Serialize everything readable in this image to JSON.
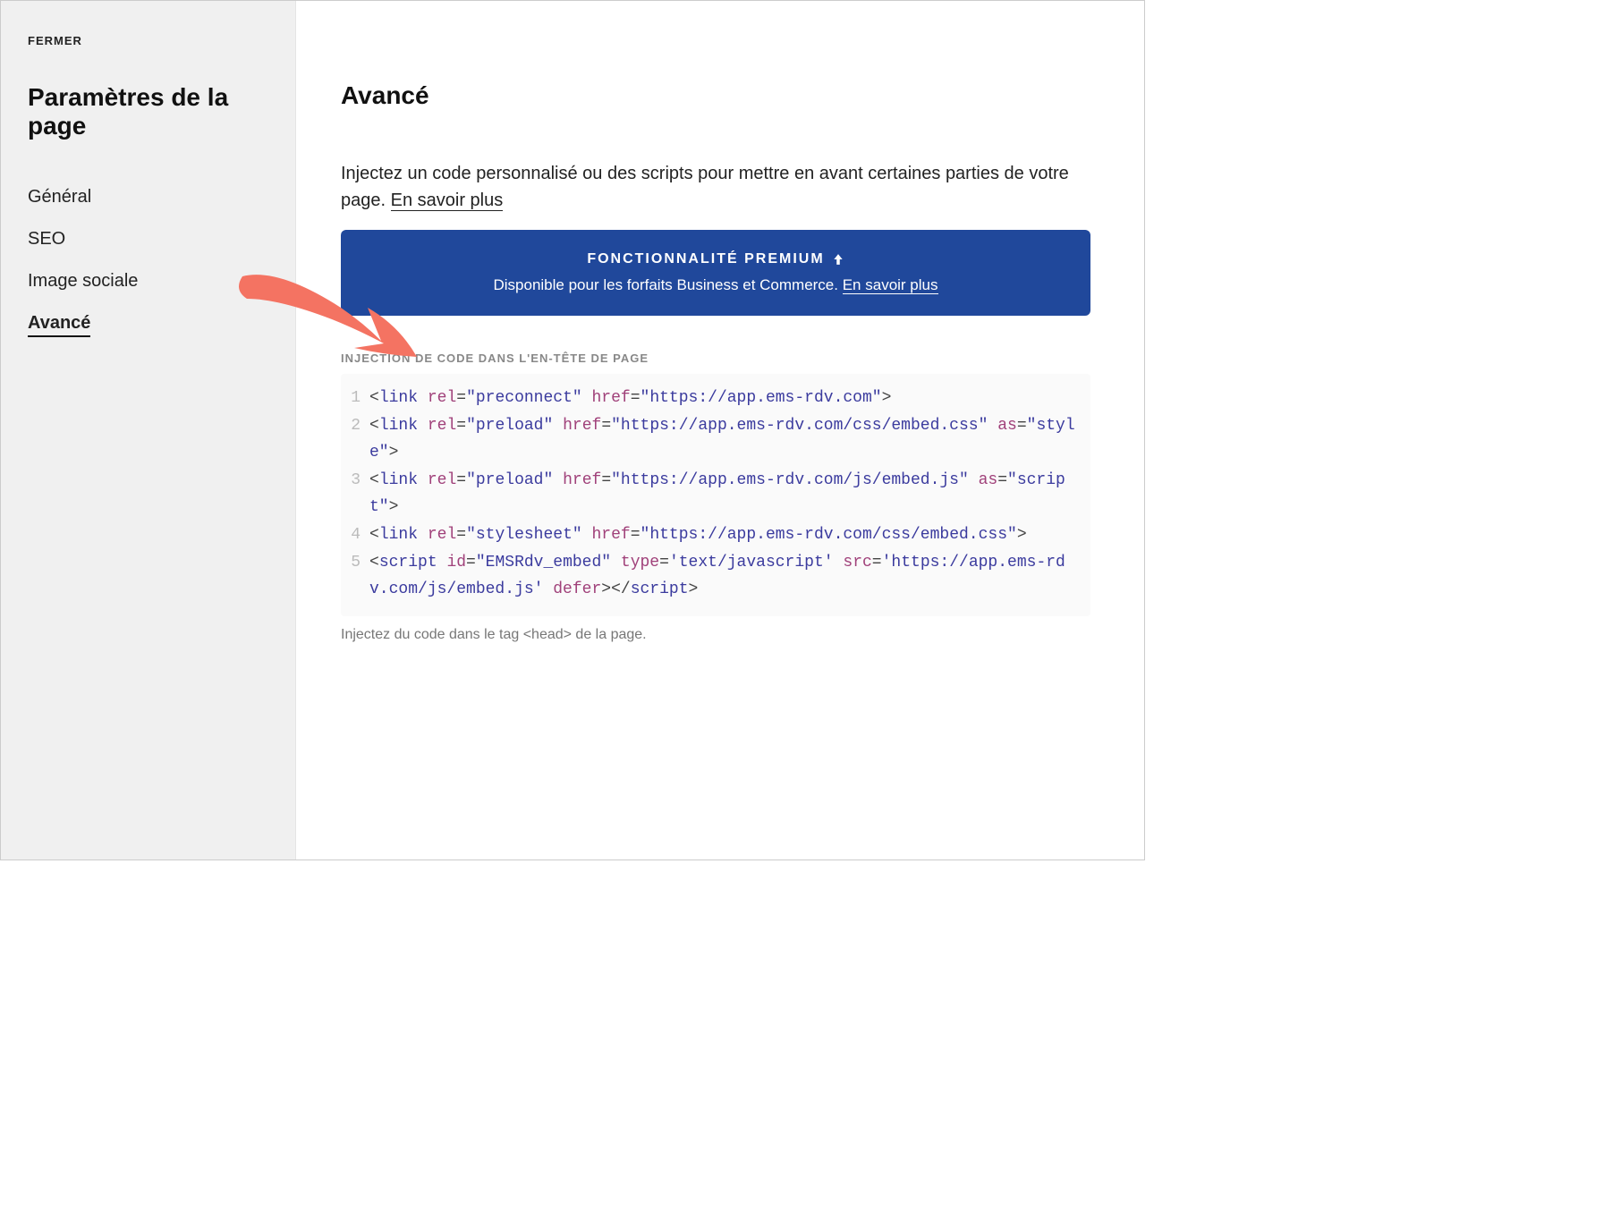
{
  "sidebar": {
    "close": "FERMER",
    "title": "Paramètres de la page",
    "items": [
      {
        "label": "Général"
      },
      {
        "label": "SEO"
      },
      {
        "label": "Image sociale"
      },
      {
        "label": "Avancé"
      }
    ]
  },
  "main": {
    "title": "Avancé",
    "intro_part1": "Injectez un code personnalisé ou des scripts pour mettre en avant certaines parties de votre page. ",
    "intro_link": "En savoir plus",
    "premium": {
      "title": "FONCTIONNALITÉ PREMIUM",
      "sub_part1": "Disponible pour les forfaits Business et Commerce. ",
      "sub_link": "En savoir plus"
    },
    "code_section_label": "INJECTION DE CODE DANS L'EN-TÊTE DE PAGE",
    "helper": "Injectez du code dans le tag <head> de la page.",
    "code_lines": [
      {
        "n": "1",
        "tokens": [
          {
            "t": "plain",
            "v": "<"
          },
          {
            "t": "tag",
            "v": "link"
          },
          {
            "t": "plain",
            "v": " "
          },
          {
            "t": "attr",
            "v": "rel"
          },
          {
            "t": "plain",
            "v": "="
          },
          {
            "t": "val",
            "v": "\"preconnect\""
          },
          {
            "t": "plain",
            "v": " "
          },
          {
            "t": "attr",
            "v": "href"
          },
          {
            "t": "plain",
            "v": "="
          },
          {
            "t": "val",
            "v": "\"https://app.ems-rdv.com\""
          },
          {
            "t": "plain",
            "v": ">"
          }
        ]
      },
      {
        "n": "2",
        "tokens": [
          {
            "t": "plain",
            "v": "<"
          },
          {
            "t": "tag",
            "v": "link"
          },
          {
            "t": "plain",
            "v": " "
          },
          {
            "t": "attr",
            "v": "rel"
          },
          {
            "t": "plain",
            "v": "="
          },
          {
            "t": "val",
            "v": "\"preload\""
          },
          {
            "t": "plain",
            "v": " "
          },
          {
            "t": "attr",
            "v": "href"
          },
          {
            "t": "plain",
            "v": "="
          },
          {
            "t": "val",
            "v": "\"https://app.ems-rdv.com/css/embed.css\""
          },
          {
            "t": "plain",
            "v": " "
          },
          {
            "t": "attr",
            "v": "as"
          },
          {
            "t": "plain",
            "v": "="
          },
          {
            "t": "val",
            "v": "\"style\""
          },
          {
            "t": "plain",
            "v": ">"
          }
        ]
      },
      {
        "n": "3",
        "tokens": [
          {
            "t": "plain",
            "v": "<"
          },
          {
            "t": "tag",
            "v": "link"
          },
          {
            "t": "plain",
            "v": " "
          },
          {
            "t": "attr",
            "v": "rel"
          },
          {
            "t": "plain",
            "v": "="
          },
          {
            "t": "val",
            "v": "\"preload\""
          },
          {
            "t": "plain",
            "v": " "
          },
          {
            "t": "attr",
            "v": "href"
          },
          {
            "t": "plain",
            "v": "="
          },
          {
            "t": "val",
            "v": "\"https://app.ems-rdv.com/js/embed.js\""
          },
          {
            "t": "plain",
            "v": " "
          },
          {
            "t": "attr",
            "v": "as"
          },
          {
            "t": "plain",
            "v": "="
          },
          {
            "t": "val",
            "v": "\"script\""
          },
          {
            "t": "plain",
            "v": ">"
          }
        ]
      },
      {
        "n": "4",
        "tokens": [
          {
            "t": "plain",
            "v": "<"
          },
          {
            "t": "tag",
            "v": "link"
          },
          {
            "t": "plain",
            "v": " "
          },
          {
            "t": "attr",
            "v": "rel"
          },
          {
            "t": "plain",
            "v": "="
          },
          {
            "t": "val",
            "v": "\"stylesheet\""
          },
          {
            "t": "plain",
            "v": " "
          },
          {
            "t": "attr",
            "v": "href"
          },
          {
            "t": "plain",
            "v": "="
          },
          {
            "t": "val",
            "v": "\"https://app.ems-rdv.com/css/embed.css\""
          },
          {
            "t": "plain",
            "v": ">"
          }
        ]
      },
      {
        "n": "5",
        "tokens": [
          {
            "t": "plain",
            "v": "<"
          },
          {
            "t": "tag",
            "v": "script"
          },
          {
            "t": "plain",
            "v": " "
          },
          {
            "t": "attr",
            "v": "id"
          },
          {
            "t": "plain",
            "v": "="
          },
          {
            "t": "val",
            "v": "\"EMSRdv_embed\""
          },
          {
            "t": "plain",
            "v": " "
          },
          {
            "t": "attr",
            "v": "type"
          },
          {
            "t": "plain",
            "v": "="
          },
          {
            "t": "val",
            "v": "'text/javascript'"
          },
          {
            "t": "plain",
            "v": " "
          },
          {
            "t": "attr",
            "v": "src"
          },
          {
            "t": "plain",
            "v": "="
          },
          {
            "t": "val",
            "v": "'https://app.ems-rdv.com/js/embed.js'"
          },
          {
            "t": "plain",
            "v": " "
          },
          {
            "t": "attr",
            "v": "defer"
          },
          {
            "t": "plain",
            "v": ">"
          },
          {
            "t": "plain",
            "v": "</"
          },
          {
            "t": "tag",
            "v": "script"
          },
          {
            "t": "plain",
            "v": ">"
          }
        ]
      }
    ]
  }
}
